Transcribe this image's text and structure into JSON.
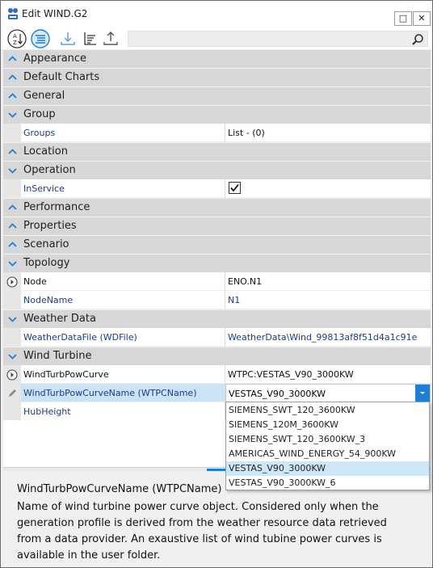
{
  "window": {
    "title": "Edit WIND.G2",
    "restore_glyph": "□",
    "close_glyph": "✕"
  },
  "toolbar": {
    "sort_alpha_icon": "sort-alphabetical-icon",
    "categorized_icon": "categorized-icon",
    "import_icon": "download-icon",
    "sort_icon": "sort-descending-icon",
    "export_icon": "upload-icon",
    "search_placeholder": "",
    "search_value": ""
  },
  "grid": {
    "categories": {
      "appearance": "Appearance",
      "default_charts": "Default Charts",
      "general": "General",
      "group": "Group",
      "location": "Location",
      "operation": "Operation",
      "performance": "Performance",
      "properties": "Properties",
      "scenario": "Scenario",
      "topology": "Topology",
      "weather_data": "Weather Data",
      "wind_turbine": "Wind Turbine"
    },
    "properties": {
      "groups": {
        "name": "Groups",
        "value": "List - (0)"
      },
      "in_service": {
        "name": "InService",
        "checked": true
      },
      "node": {
        "name": "Node",
        "value": "ENO.N1"
      },
      "node_name": {
        "name": "NodeName",
        "value": "N1"
      },
      "weather_data_file": {
        "name": "WeatherDataFile (WDFile)",
        "value": "WeatherData\\Wind_99813af8f51d4a1c91e"
      },
      "wind_turb_pow_curve": {
        "name": "WindTurbPowCurve",
        "value": "WTPC:VESTAS_V90_3000KW"
      },
      "wtpc_name": {
        "name": "WindTurbPowCurveName (WTPCName)",
        "value": "VESTAS_V90_3000KW"
      },
      "hub_height": {
        "name": "HubHeight",
        "value": ""
      }
    }
  },
  "dropdown": {
    "options": [
      "SIEMENS_SWT_120_3600KW",
      "SIEMENS_120M_3600KW",
      "SIEMENS_SWT_120_3600KW_3",
      "AMERICAS_WIND_ENERGY_54_900KW",
      "VESTAS_V90_3000KW",
      "VESTAS_V90_3000KW_6"
    ],
    "selected": "VESTAS_V90_3000KW"
  },
  "description": {
    "title": "WindTurbPowCurveName (WTPCName)",
    "text": "Name of wind turbine power curve object. Considered only when the generation profile is derived from the weather resource data retrieved from a data provider. An exaustive list of wind tubine power curves is available in the user folder."
  },
  "colors": {
    "accent": "#1f7fd4",
    "category_bg": "#d7d7d7",
    "selected_row": "#cbe3f7",
    "link_text": "#1c3b8c"
  }
}
